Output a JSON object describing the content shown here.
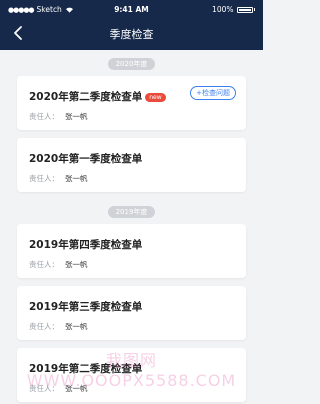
{
  "status_bar": {
    "carrier": "Sketch",
    "time": "9:41 AM",
    "battery": "100%"
  },
  "nav": {
    "title": "季度检查"
  },
  "sections": [
    {
      "year_label": "2020年度",
      "cards": [
        {
          "title": "2020年第二季度检查单",
          "badge": "new",
          "action": "+检查问题",
          "owner_label": "责任人：",
          "owner": "张一帆"
        },
        {
          "title": "2020年第一季度检查单",
          "owner_label": "责任人：",
          "owner": "张一帆"
        }
      ]
    },
    {
      "year_label": "2019年度",
      "cards": [
        {
          "title": "2019年第四季度检查单",
          "owner_label": "责任人：",
          "owner": "张一帆"
        },
        {
          "title": "2019年第三季度检查单",
          "owner_label": "责任人：",
          "owner": "张一帆"
        },
        {
          "title": "2019年第二季度检查单",
          "owner_label": "责任人：",
          "owner": "张一帆"
        }
      ]
    }
  ],
  "watermark": "我图网 WWW.OOOPX5588.COM",
  "colors": {
    "header": "#17294b",
    "accent": "#3c7ff0",
    "badge": "#e84b3c",
    "background": "#f2f3f5"
  }
}
